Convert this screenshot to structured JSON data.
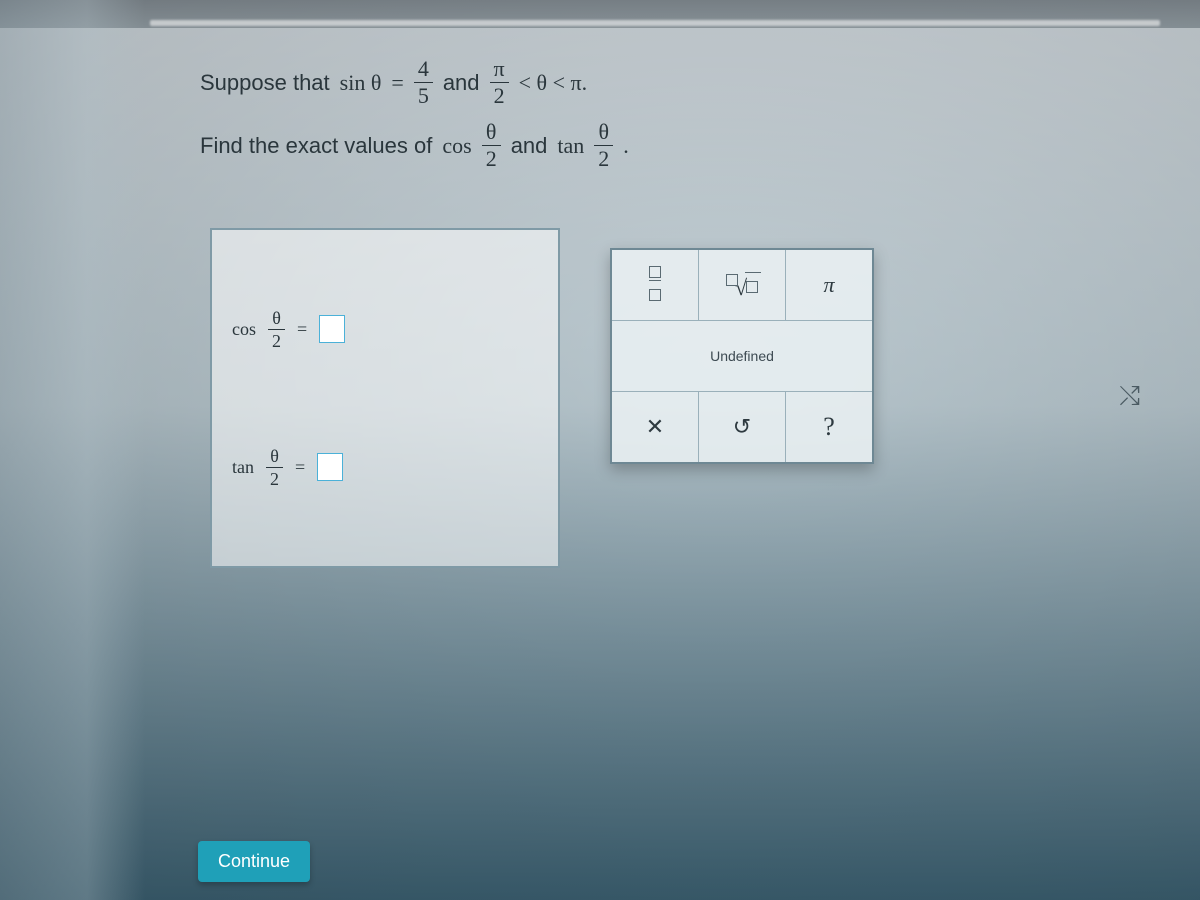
{
  "problem": {
    "line1_prefix": "Suppose that",
    "sin_lhs": "sin θ",
    "equals": "=",
    "frac1_num": "4",
    "frac1_den": "5",
    "and1": "and",
    "frac2_num": "π",
    "frac2_den": "2",
    "ineq": "< θ < π.",
    "line2_prefix": "Find the exact values of",
    "cos": "cos",
    "theta_over_2_num": "θ",
    "theta_over_2_den": "2",
    "and2": "and",
    "tan": "tan",
    "period": "."
  },
  "answers": {
    "cos_label": "cos",
    "tan_label": "tan",
    "half_num": "θ",
    "half_den": "2",
    "eq": "="
  },
  "toolbox": {
    "undefined_label": "Undefined",
    "pi_label": "π",
    "clear_label": "✕",
    "undo_label": "↺",
    "help_label": "?"
  },
  "continue_label": "Continue"
}
